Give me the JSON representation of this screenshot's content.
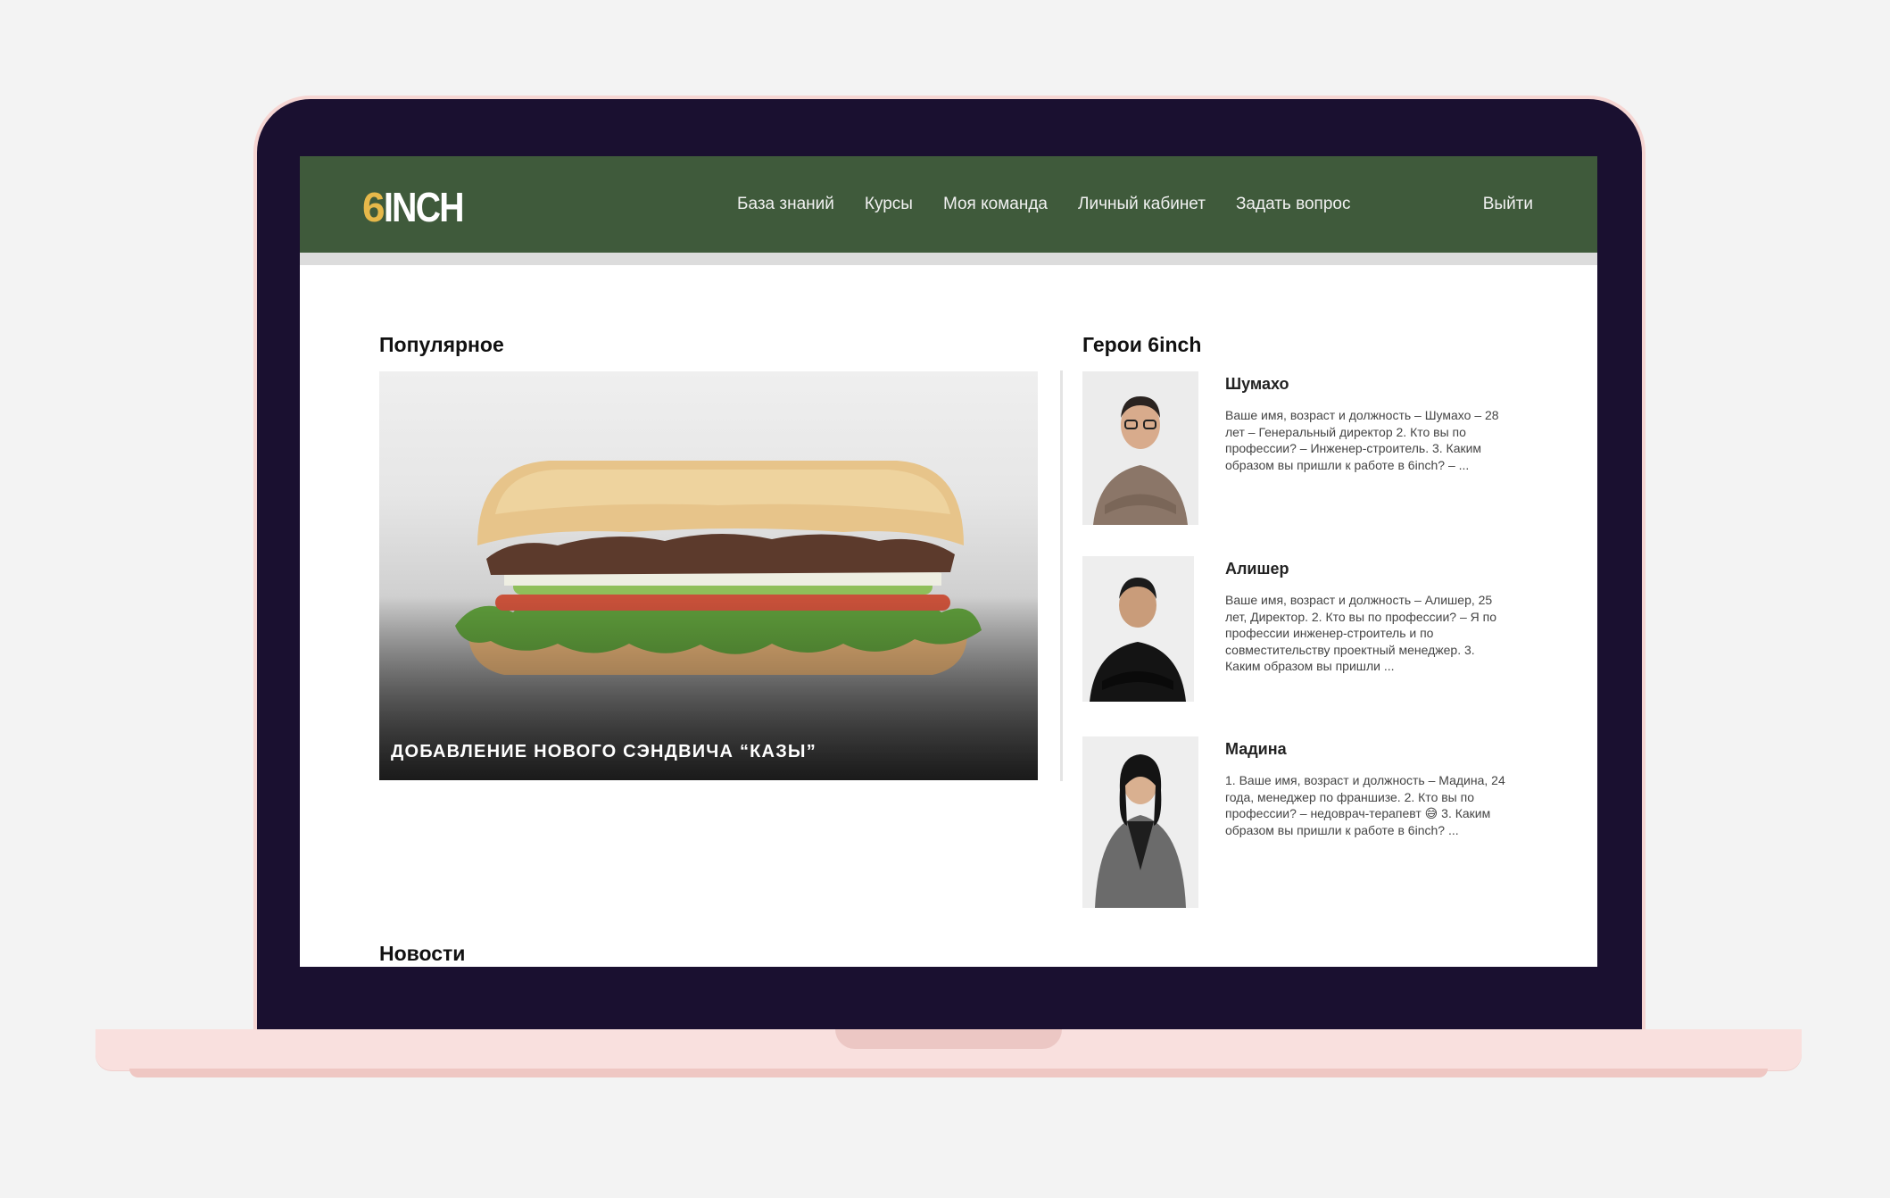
{
  "brand": {
    "logo_number": "6",
    "logo_word": "INCH",
    "nav_color": "#3f5a3b",
    "accent_color": "#e6b84a"
  },
  "nav": {
    "items": [
      {
        "label": "База знаний"
      },
      {
        "label": "Курсы"
      },
      {
        "label": "Моя команда"
      },
      {
        "label": "Личный кабинет"
      },
      {
        "label": "Задать вопрос"
      }
    ],
    "logout_label": "Выйти"
  },
  "popular": {
    "title": "Популярное",
    "card_caption": "Добавление нового сэндвича “Казы”"
  },
  "heroes": {
    "title": "Герои 6inch",
    "items": [
      {
        "name": "Шумахо",
        "text": "Ваше имя, возраст и должность – Шумахо – 28 лет – Генеральный директор 2. Кто вы по профессии? – Инженер-строитель. 3. Каким образом вы пришли к работе в 6inch? – ..."
      },
      {
        "name": "Алишер",
        "text": "Ваше имя, возраст и должность – Алишер, 25 лет, Директор. 2. Кто вы по профессии? – Я по профессии инженер-строитель и по совместительству проектный менеджер. 3. Каким образом вы пришли ..."
      },
      {
        "name": "Мадина",
        "text": "1. Ваше имя, возраст и должность – Мадина, 24 года, менеджер по франшизе. 2. Кто вы по профессии? – недоврач-терапевт 😅 3. Каким образом вы пришли к работе в 6inch? ..."
      }
    ]
  },
  "news": {
    "title": "Новости"
  }
}
